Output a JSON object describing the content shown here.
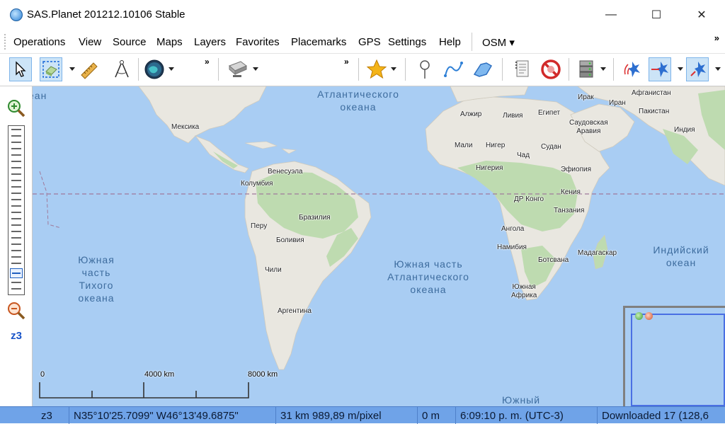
{
  "window": {
    "title": "SAS.Planet 201212.10106 Stable",
    "controls": {
      "minimize": "—",
      "maximize": "☐",
      "close": "✕"
    }
  },
  "menu": {
    "items": [
      "Operations",
      "View",
      "Source",
      "Maps",
      "Layers",
      "Favorites",
      "Placemarks",
      "GPS",
      "Settings",
      "Help"
    ],
    "map_source": "OSM ▾",
    "overflow": "»"
  },
  "toolbar": {
    "overflow": "»",
    "tools": [
      "pointer-icon",
      "selection-icon",
      "ruler-icon",
      "compass-icon",
      "globe-icon",
      "gps-device-icon",
      "star-icon",
      "placemark-pin-icon",
      "path-icon",
      "polygon-icon",
      "notes-icon",
      "stop-icon",
      "database-icon",
      "gps-track-icon",
      "gps-track-active-icon",
      "gps-track-center-icon"
    ]
  },
  "zoom": {
    "level_label": "z3"
  },
  "map": {
    "ocean_labels": [
      {
        "text": "еан"
      },
      {
        "text": "Атлантического\nокеана"
      },
      {
        "text": "Южная\nчасть\nТихого\nокеана"
      },
      {
        "text": "Южная часть\nАтлантического\nокеана"
      },
      {
        "text": "Индийский\nокеан"
      },
      {
        "text": "Южный"
      }
    ],
    "place_labels": [
      "Мексика",
      "Венесуэла",
      "Колумбия",
      "Бразилия",
      "Перу",
      "Боливия",
      "Чили",
      "Аргентина",
      "Алжир",
      "Ливия",
      "Египет",
      "Ирак",
      "Иран",
      "Афганистан",
      "Пакистан",
      "Индия",
      "Саудовская\nАравия",
      "Мали",
      "Нигер",
      "Чад",
      "Судан",
      "Нигерия",
      "Эфиопия",
      "Кения",
      "ДР Конго",
      "Танзания",
      "Ангола",
      "Намибия",
      "Ботсвана",
      "Мадагаскар",
      "Южная\nАфрика"
    ]
  },
  "scale": {
    "labels": [
      "0",
      "4000 km",
      "8000 km"
    ]
  },
  "status": {
    "zoom": "z3",
    "coords": "N35°10'25.7099\" W46°13'49.6875\"",
    "resolution": "31 km 989,89 m/pixel",
    "distance": "0 m",
    "time": "6:09:10 p. m. (UTC-3)",
    "downloaded": "Downloaded 17 (128,6"
  },
  "colors": {
    "ocean": "#a9cdf3",
    "land": "#e9e7e0",
    "vegetation": "#bedbb0",
    "status_bar": "#6fa3e8",
    "accent": "#1a55c9"
  }
}
